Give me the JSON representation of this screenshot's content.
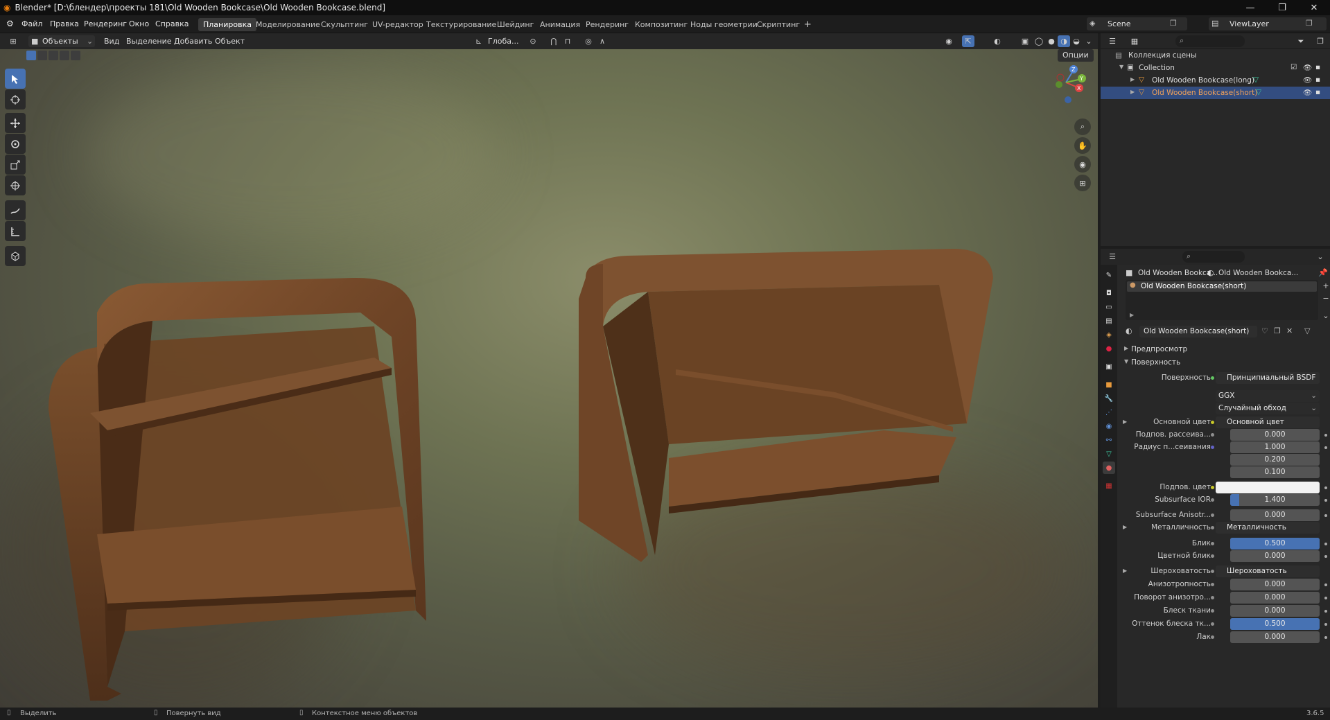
{
  "title_bar": {
    "title": "Blender* [D:\\блендер\\проекты 181\\Old Wooden Bookcase\\Old Wooden Bookcase.blend]",
    "minimize": "—",
    "maximize": "❐",
    "close": "✕"
  },
  "menu": {
    "items": [
      "Файл",
      "Правка",
      "Рендеринг",
      "Окно",
      "Справка"
    ]
  },
  "workspaces": {
    "tabs": [
      "Планировка",
      "Моделирование",
      "Скульптинг",
      "UV-редактор",
      "Текстурирование",
      "Шейдинг",
      "Анимация",
      "Рендеринг",
      "Композитинг",
      "Ноды геометрии",
      "Скриптинг"
    ],
    "active": "Планировка",
    "add": "+"
  },
  "scene": {
    "label": "Scene",
    "viewlayer": "ViewLayer"
  },
  "viewport_header": {
    "mode": "Объекты",
    "view": "Вид",
    "select": "Выделение",
    "add": "Добавить",
    "object": "Объект",
    "orientation": "Глоба...",
    "options": "Опции"
  },
  "gizmo": {
    "x": "X",
    "y": "Y",
    "z": "Z"
  },
  "outliner": {
    "root": "Коллекция сцены",
    "collection": "Collection",
    "objects": [
      {
        "name": "Old Wooden Bookcase(long)",
        "selected": false
      },
      {
        "name": "Old Wooden Bookcase(short)",
        "selected": true
      }
    ]
  },
  "properties": {
    "breadcrumb_object": "Old Wooden Bookca...",
    "breadcrumb_material": "Old Wooden Bookca...",
    "slot": "Old Wooden Bookcase(short)",
    "material_name": "Old Wooden Bookcase(short)",
    "sections": {
      "preview": "Предпросмотр",
      "surface": "Поверхность"
    },
    "surface_label": "Поверхность",
    "surface_value": "Принципиальный BSDF",
    "distribution": "GGX",
    "subsurface_method": "Случайный обход",
    "rows": [
      {
        "label": "Основной цвет",
        "value": "Основной цвет",
        "kind": "link",
        "dot": "yellow"
      },
      {
        "label": "Подпов. рассеива...",
        "value": "0.000",
        "kind": "num",
        "dot": "gray"
      },
      {
        "label": "Радиус п...сеивания",
        "value": "1.000",
        "kind": "num",
        "dot": "blue"
      },
      {
        "label": "",
        "value": "0.200",
        "kind": "num",
        "dot": ""
      },
      {
        "label": "",
        "value": "0.100",
        "kind": "num",
        "dot": ""
      },
      {
        "label": "Подпов. цвет",
        "value": "",
        "kind": "color",
        "dot": "yellow"
      },
      {
        "label": "Subsurface IOR",
        "value": "1.400",
        "kind": "bar",
        "fill": 0.1,
        "dot": "gray"
      },
      {
        "label": "Subsurface Anisotr...",
        "value": "0.000",
        "kind": "num",
        "dot": "gray"
      },
      {
        "label": "Металличность",
        "value": "Металличность",
        "kind": "link",
        "dot": "gray"
      },
      {
        "label": "Блик",
        "value": "0.500",
        "kind": "bar",
        "fill": 1.0,
        "dot": "gray"
      },
      {
        "label": "Цветной блик",
        "value": "0.000",
        "kind": "num",
        "dot": "gray"
      },
      {
        "label": "Шероховатость",
        "value": "Шероховатость",
        "kind": "link",
        "dot": "gray"
      },
      {
        "label": "Анизотропность",
        "value": "0.000",
        "kind": "num",
        "dot": "gray"
      },
      {
        "label": "Поворот анизотро...",
        "value": "0.000",
        "kind": "num",
        "dot": "gray"
      },
      {
        "label": "Блеск ткани",
        "value": "0.000",
        "kind": "num",
        "dot": "gray"
      },
      {
        "label": "Оттенок блеска тк...",
        "value": "0.500",
        "kind": "bar",
        "fill": 1.0,
        "dot": "gray"
      },
      {
        "label": "Лак",
        "value": "0.000",
        "kind": "num",
        "dot": "gray"
      }
    ]
  },
  "status": {
    "select": "Выделить",
    "rotate": "Повернуть вид",
    "context": "Контекстное меню объектов",
    "version": "3.6.5"
  }
}
